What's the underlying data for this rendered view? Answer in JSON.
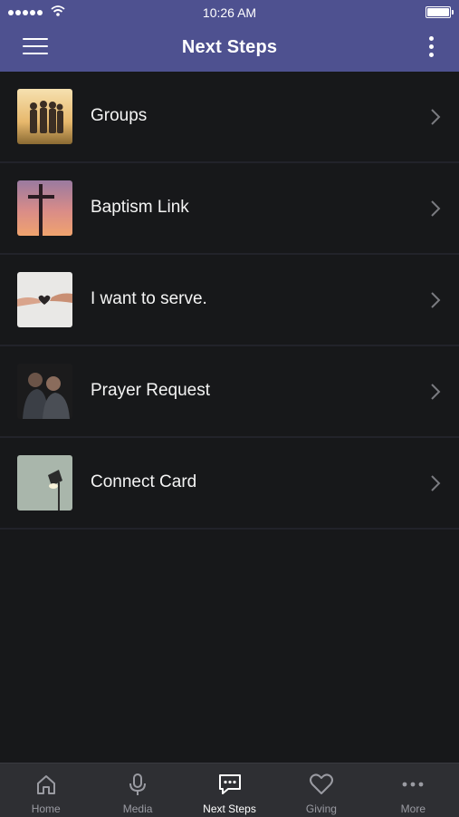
{
  "status_bar": {
    "time": "10:26 AM"
  },
  "header": {
    "title": "Next Steps"
  },
  "items": [
    {
      "label": "Groups",
      "thumb": "group-photo"
    },
    {
      "label": "Baptism Link",
      "thumb": "cross-sunset-photo"
    },
    {
      "label": "I want to serve.",
      "thumb": "hands-heart-photo"
    },
    {
      "label": "Prayer Request",
      "thumb": "praying-people-photo"
    },
    {
      "label": "Connect Card",
      "thumb": "lamp-photo"
    }
  ],
  "tabs": [
    {
      "label": "Home",
      "icon": "home-icon",
      "active": false
    },
    {
      "label": "Media",
      "icon": "microphone-icon",
      "active": false
    },
    {
      "label": "Next Steps",
      "icon": "chat-bubble-icon",
      "active": true
    },
    {
      "label": "Giving",
      "icon": "heart-icon",
      "active": false
    },
    {
      "label": "More",
      "icon": "ellipsis-icon",
      "active": false
    }
  ],
  "colors": {
    "header_bg": "#4e5190",
    "background": "#17181a",
    "tabbar_bg": "#2e2f33"
  }
}
